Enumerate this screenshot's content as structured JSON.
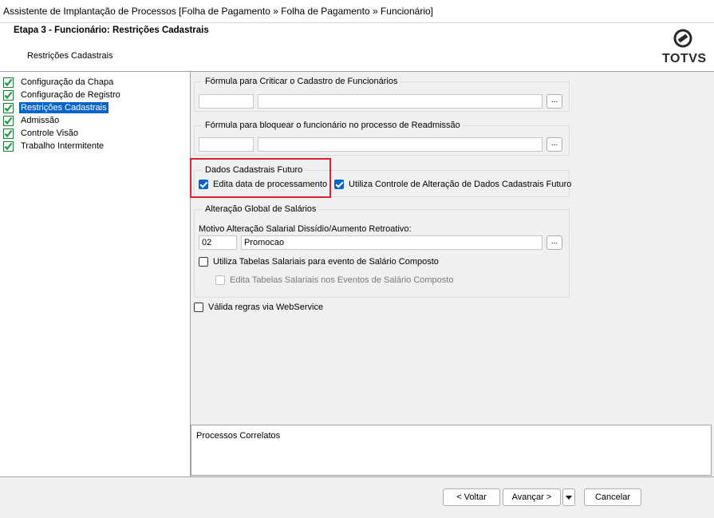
{
  "window": {
    "title": "Assistente de Implantação de Processos [Folha de Pagamento » Folha de Pagamento » Funcionário]"
  },
  "header": {
    "step_title": "Etapa 3 - Funcionário: Restrições Cadastrais",
    "step_subtitle": "Restrições Cadastrais",
    "logo_text": "TOTVS"
  },
  "tree": {
    "items": [
      {
        "label": "Configuração da Chapa",
        "checked": true
      },
      {
        "label": "Configuração de Registro",
        "checked": true
      },
      {
        "label": "Restrições Cadastrais",
        "checked": true,
        "selected": true
      },
      {
        "label": "Admissão",
        "checked": true
      },
      {
        "label": "Controle Visão",
        "checked": true
      },
      {
        "label": "Trabalho Intermitente",
        "checked": true
      }
    ]
  },
  "form": {
    "formula_critica": {
      "title": "Fórmula para Criticar o Cadastro de Funcionários",
      "code": "",
      "description": "",
      "button": "..."
    },
    "formula_bloqueio": {
      "title": "Fórmula para bloquear o funcionário no processo de Readmissão",
      "code": "",
      "description": "",
      "button": "..."
    },
    "dados_futuro": {
      "title": "Dados Cadastrais Futuro",
      "edita_data": {
        "label": "Edita data de processamento",
        "checked": true
      },
      "utiliza_controle": {
        "label": "Utiliza Controle de Alteração de Dados Cadastrais Futuro",
        "checked": true
      }
    },
    "alteracao_global": {
      "title": "Alteração Global de Salários",
      "motivo_label": "Motivo Alteração Salarial Dissídio/Aumento Retroativo:",
      "motivo_code": "02",
      "motivo_desc": "Promocao",
      "button": "...",
      "tabelas_salariais": {
        "label": "Utiliza Tabelas Salariais para evento de Salário Composto",
        "checked": false
      },
      "edita_tabelas": {
        "label": "Edita Tabelas Salariais nos Eventos de Salário Composto",
        "checked": false,
        "disabled": true
      }
    },
    "valida_webservice": {
      "label": "Válida regras via WebService",
      "checked": false
    }
  },
  "related": {
    "title": "Processos Correlatos"
  },
  "footer": {
    "back": "< Voltar",
    "next": "Avançar >",
    "cancel": "Cancelar"
  },
  "colors": {
    "accent": "#0a64c8",
    "highlight": "#d9232e"
  }
}
